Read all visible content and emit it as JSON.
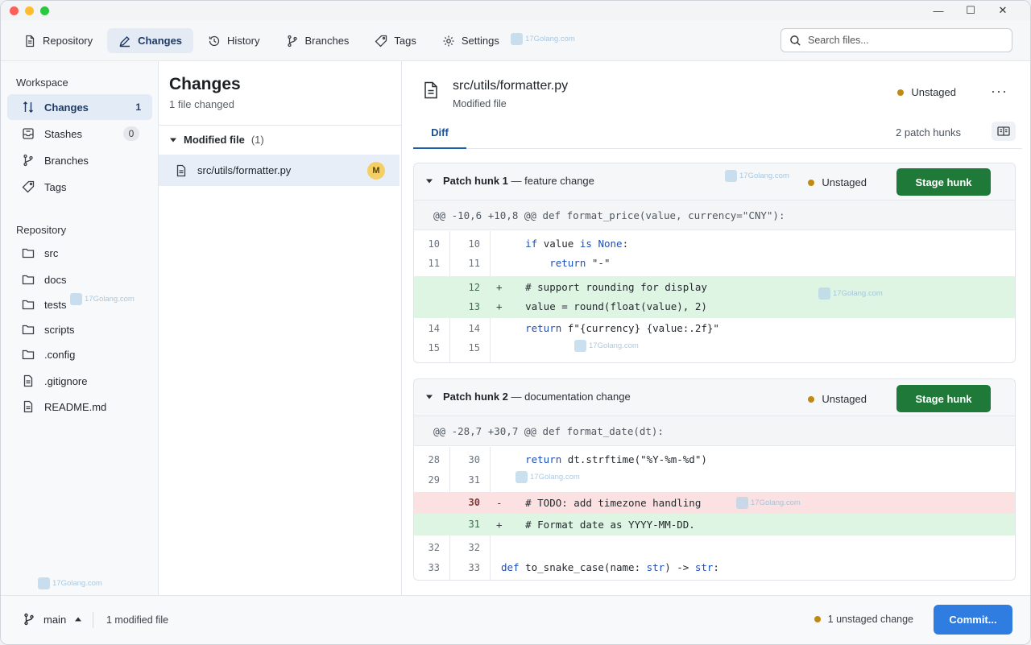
{
  "window": {
    "controls": {
      "minimize": "—",
      "maximize": "☐",
      "close": "✕"
    }
  },
  "toolbar": {
    "tabs": [
      {
        "label": "Repository",
        "icon": "document-icon"
      },
      {
        "label": "Changes",
        "icon": "edit-icon",
        "active": true
      },
      {
        "label": "History",
        "icon": "history-icon"
      },
      {
        "label": "Branches",
        "icon": "branch-icon"
      },
      {
        "label": "Tags",
        "icon": "tag-icon"
      },
      {
        "label": "Settings",
        "icon": "gear-icon"
      }
    ],
    "search_placeholder": "Search files..."
  },
  "watermark": "17Golang.com",
  "sidebar": {
    "workspace_heading": "Workspace",
    "workspace_items": [
      {
        "label": "Changes",
        "count": "1",
        "icon": "changes-icon",
        "active": true
      },
      {
        "label": "Stashes",
        "count": "0",
        "icon": "stash-icon"
      },
      {
        "label": "Branches",
        "icon": "branch-icon"
      },
      {
        "label": "Tags",
        "icon": "tag-icon"
      }
    ],
    "repository_heading": "Repository",
    "repository_items": [
      {
        "label": "src",
        "icon": "folder-icon"
      },
      {
        "label": "docs",
        "icon": "folder-icon"
      },
      {
        "label": "tests",
        "icon": "folder-icon"
      },
      {
        "label": "scripts",
        "icon": "folder-icon"
      },
      {
        "label": ".config",
        "icon": "folder-icon"
      },
      {
        "label": ".gitignore",
        "icon": "file-icon"
      },
      {
        "label": "README.md",
        "icon": "file-icon"
      }
    ]
  },
  "changes": {
    "title": "Changes",
    "subtitle": "1 file changed",
    "group_label": "Modified file",
    "group_count": "(1)",
    "file": {
      "path": "src/utils/formatter.py",
      "badge": "M"
    }
  },
  "diff": {
    "file_path": "src/utils/formatter.py",
    "file_status": "Modified file",
    "status": "Unstaged",
    "more": "···",
    "tab": "Diff",
    "hunk_count": "2 patch hunks",
    "hunks": [
      {
        "name": "Patch hunk 1",
        "desc": "— feature change",
        "status": "Unstaged",
        "button": "Stage hunk",
        "range": "@@ -10,6 +10,8 @@ def format_price(value, currency=\"CNY\"):",
        "lines": [
          {
            "old": "10",
            "new": "10",
            "sign": "",
            "type": "ctx",
            "code": "    if value is None:"
          },
          {
            "old": "11",
            "new": "11",
            "sign": "",
            "type": "ctx",
            "code": "        return \"-\""
          },
          {
            "old": "",
            "new": "12",
            "sign": "+",
            "type": "add",
            "code": "    # support rounding for display"
          },
          {
            "old": "",
            "new": "13",
            "sign": "+",
            "type": "add",
            "code": "    value = round(float(value), 2)"
          },
          {
            "old": "14",
            "new": "14",
            "sign": "",
            "type": "ctx",
            "code": "    return f\"{currency} {value:.2f}\""
          },
          {
            "old": "15",
            "new": "15",
            "sign": "",
            "type": "ctx",
            "code": ""
          }
        ]
      },
      {
        "name": "Patch hunk 2",
        "desc": "— documentation change",
        "status": "Unstaged",
        "button": "Stage hunk",
        "range": "@@ -28,7 +30,7 @@ def format_date(dt):",
        "lines": [
          {
            "old": "28",
            "new": "30",
            "sign": "",
            "type": "ctx",
            "code": "    return dt.strftime(\"%Y-%m-%d\")"
          },
          {
            "old": "29",
            "new": "31",
            "sign": "",
            "type": "ctx",
            "code": ""
          },
          {
            "old": "",
            "new": "30",
            "sign": "-",
            "type": "del",
            "code": "    # TODO: add timezone handling"
          },
          {
            "old": "",
            "new": "31",
            "sign": "+",
            "type": "add",
            "code": "    # Format date as YYYY-MM-DD."
          },
          {
            "old": "32",
            "new": "32",
            "sign": "",
            "type": "ctx",
            "code": ""
          },
          {
            "old": "33",
            "new": "33",
            "sign": "",
            "type": "ctx",
            "code": "def to_snake_case(name: str) -> str:"
          }
        ]
      }
    ]
  },
  "footer": {
    "branch": "main",
    "modified": "1 modified file",
    "unstaged": "1 unstaged change",
    "commit": "Commit..."
  },
  "colors": {
    "accent": "#2f7de1",
    "stage_button": "#1f7a3a",
    "added_bg": "#dff5e3",
    "removed_bg": "#fbe1e1",
    "unstaged_dot": "#c08a12",
    "modified_badge": "#f3cf66"
  }
}
